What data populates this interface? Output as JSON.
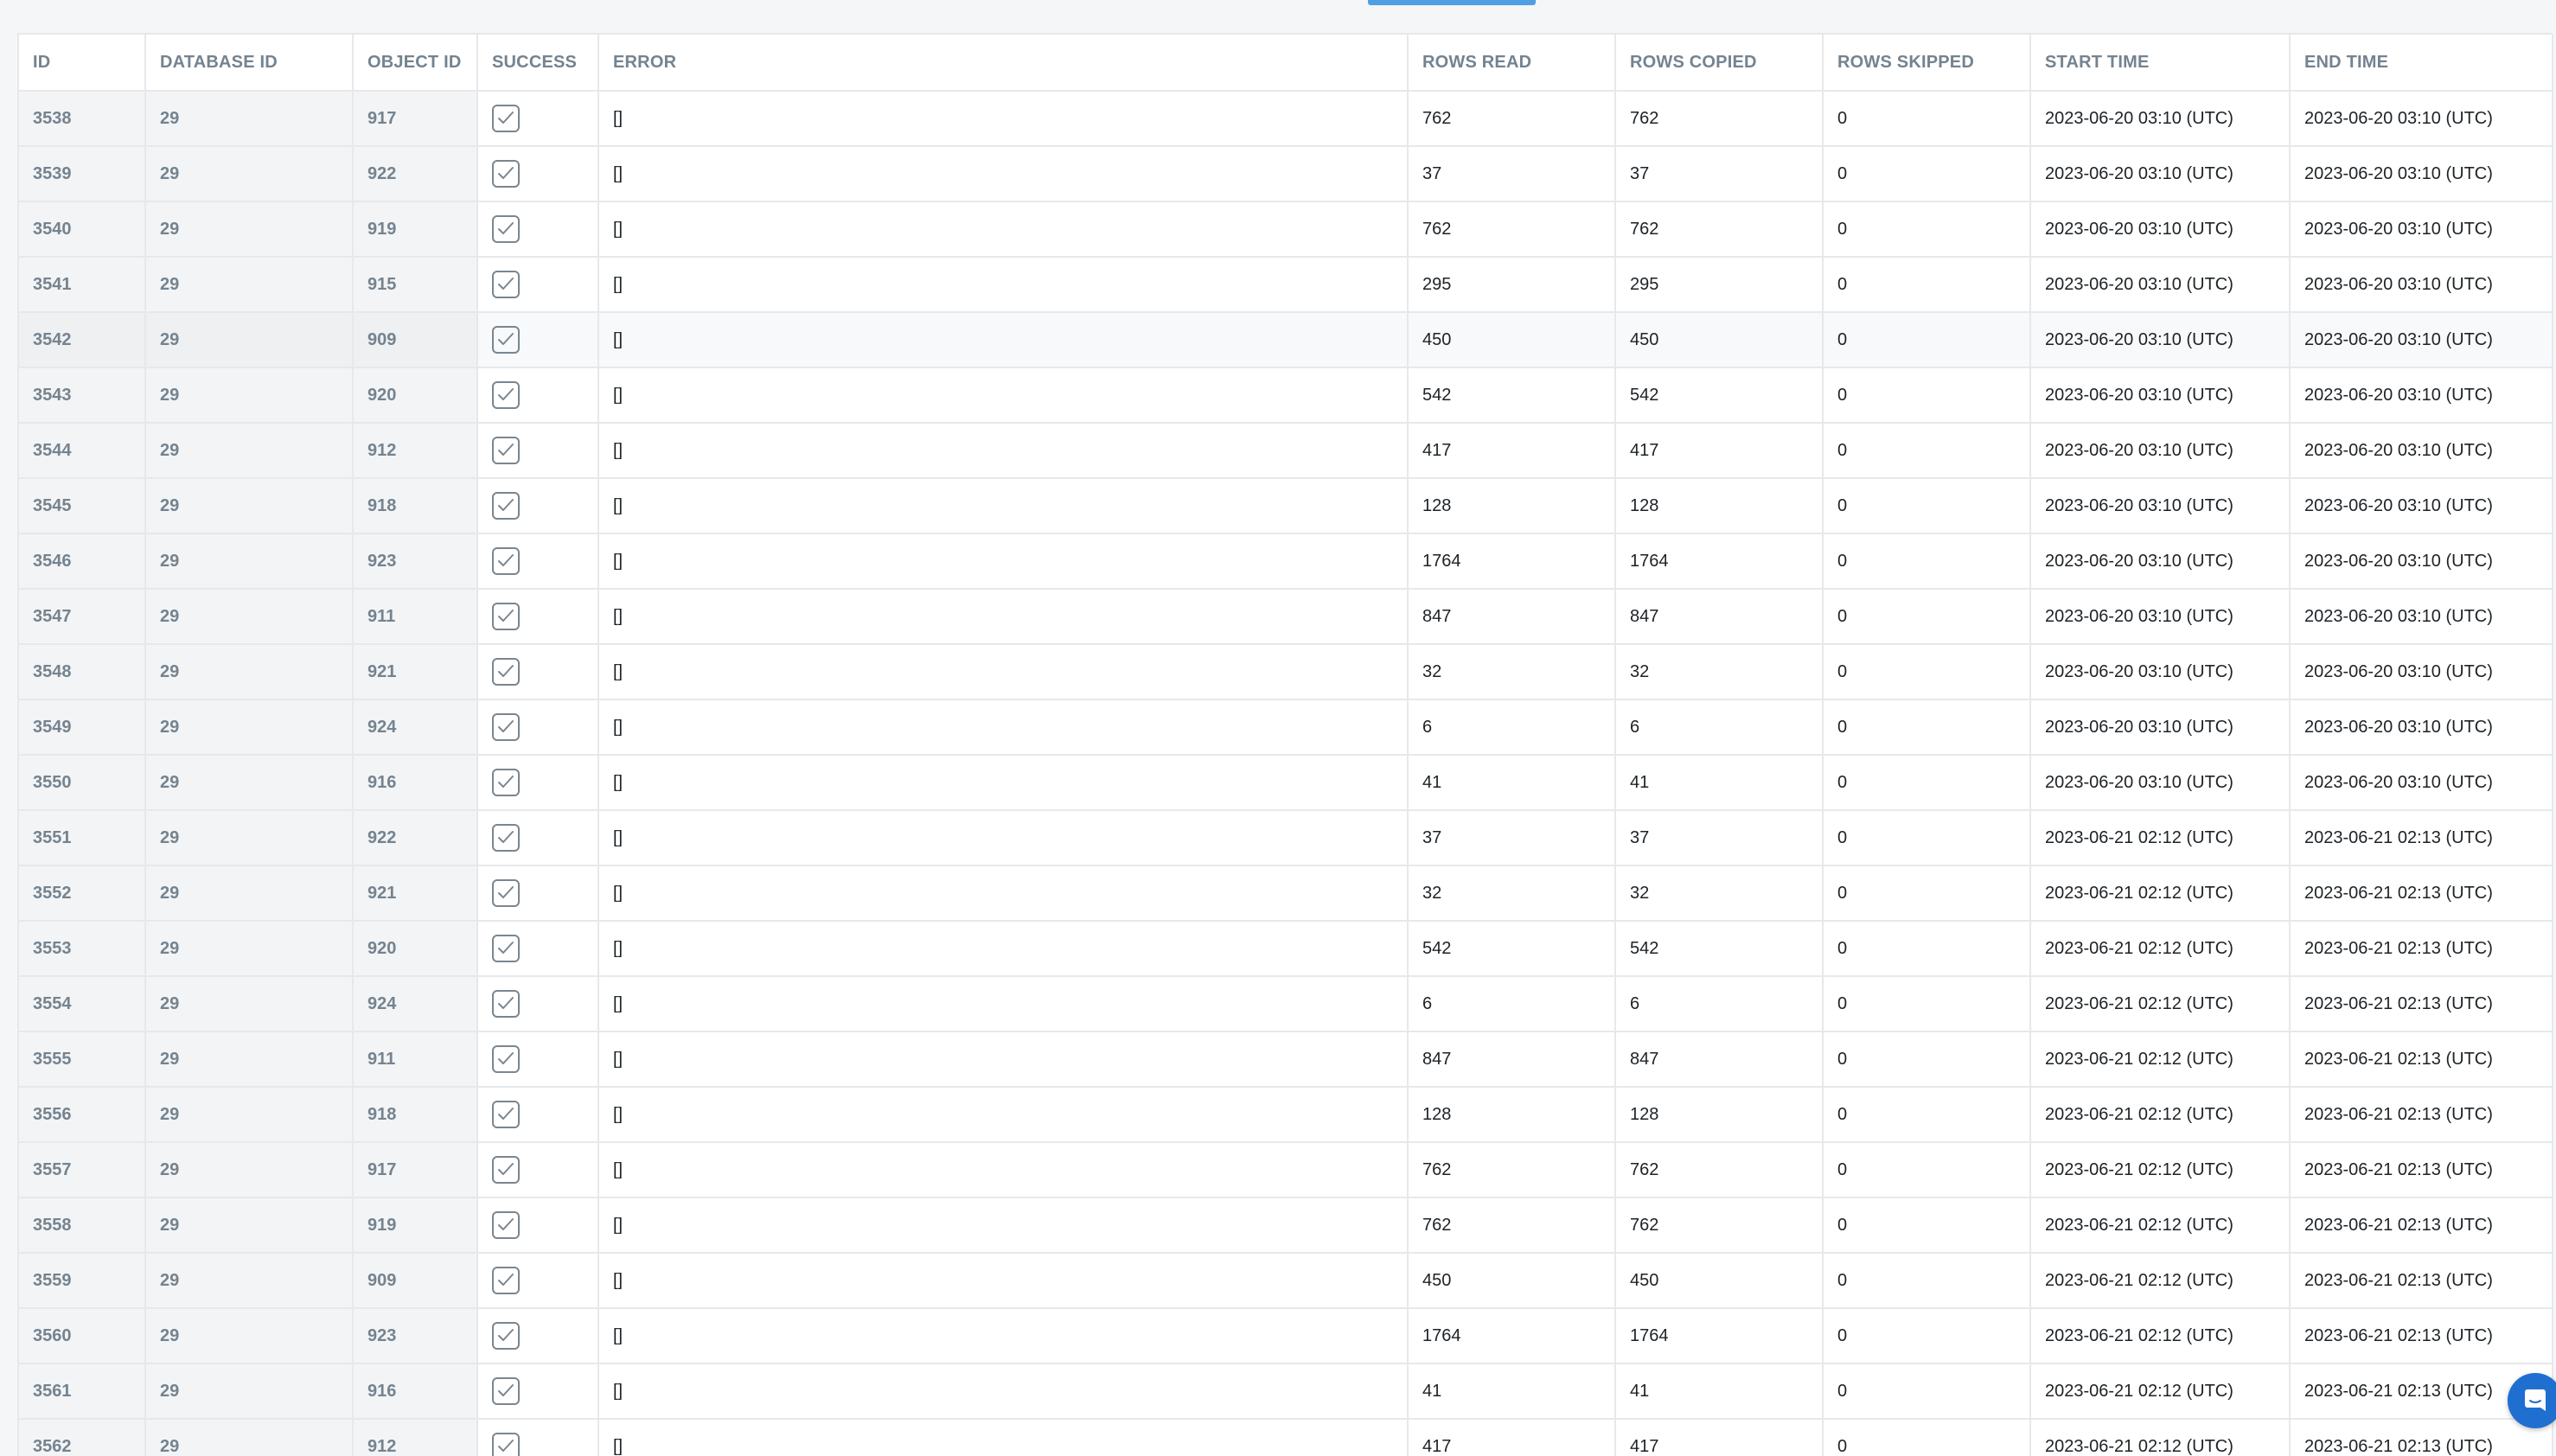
{
  "table": {
    "columns": [
      "ID",
      "DATABASE ID",
      "OBJECT ID",
      "SUCCESS",
      "ERROR",
      "ROWS READ",
      "ROWS COPIED",
      "ROWS SKIPPED",
      "START TIME",
      "END TIME"
    ],
    "rows": [
      {
        "id": "3538",
        "database_id": "29",
        "object_id": "917",
        "success": true,
        "error": "[]",
        "rows_read": "762",
        "rows_copied": "762",
        "rows_skipped": "0",
        "start_time": "2023-06-20 03:10 (UTC)",
        "end_time": "2023-06-20 03:10 (UTC)"
      },
      {
        "id": "3539",
        "database_id": "29",
        "object_id": "922",
        "success": true,
        "error": "[]",
        "rows_read": "37",
        "rows_copied": "37",
        "rows_skipped": "0",
        "start_time": "2023-06-20 03:10 (UTC)",
        "end_time": "2023-06-20 03:10 (UTC)"
      },
      {
        "id": "3540",
        "database_id": "29",
        "object_id": "919",
        "success": true,
        "error": "[]",
        "rows_read": "762",
        "rows_copied": "762",
        "rows_skipped": "0",
        "start_time": "2023-06-20 03:10 (UTC)",
        "end_time": "2023-06-20 03:10 (UTC)"
      },
      {
        "id": "3541",
        "database_id": "29",
        "object_id": "915",
        "success": true,
        "error": "[]",
        "rows_read": "295",
        "rows_copied": "295",
        "rows_skipped": "0",
        "start_time": "2023-06-20 03:10 (UTC)",
        "end_time": "2023-06-20 03:10 (UTC)"
      },
      {
        "id": "3542",
        "database_id": "29",
        "object_id": "909",
        "success": true,
        "error": "[]",
        "rows_read": "450",
        "rows_copied": "450",
        "rows_skipped": "0",
        "start_time": "2023-06-20 03:10 (UTC)",
        "end_time": "2023-06-20 03:10 (UTC)",
        "hover": true
      },
      {
        "id": "3543",
        "database_id": "29",
        "object_id": "920",
        "success": true,
        "error": "[]",
        "rows_read": "542",
        "rows_copied": "542",
        "rows_skipped": "0",
        "start_time": "2023-06-20 03:10 (UTC)",
        "end_time": "2023-06-20 03:10 (UTC)"
      },
      {
        "id": "3544",
        "database_id": "29",
        "object_id": "912",
        "success": true,
        "error": "[]",
        "rows_read": "417",
        "rows_copied": "417",
        "rows_skipped": "0",
        "start_time": "2023-06-20 03:10 (UTC)",
        "end_time": "2023-06-20 03:10 (UTC)"
      },
      {
        "id": "3545",
        "database_id": "29",
        "object_id": "918",
        "success": true,
        "error": "[]",
        "rows_read": "128",
        "rows_copied": "128",
        "rows_skipped": "0",
        "start_time": "2023-06-20 03:10 (UTC)",
        "end_time": "2023-06-20 03:10 (UTC)"
      },
      {
        "id": "3546",
        "database_id": "29",
        "object_id": "923",
        "success": true,
        "error": "[]",
        "rows_read": "1764",
        "rows_copied": "1764",
        "rows_skipped": "0",
        "start_time": "2023-06-20 03:10 (UTC)",
        "end_time": "2023-06-20 03:10 (UTC)"
      },
      {
        "id": "3547",
        "database_id": "29",
        "object_id": "911",
        "success": true,
        "error": "[]",
        "rows_read": "847",
        "rows_copied": "847",
        "rows_skipped": "0",
        "start_time": "2023-06-20 03:10 (UTC)",
        "end_time": "2023-06-20 03:10 (UTC)"
      },
      {
        "id": "3548",
        "database_id": "29",
        "object_id": "921",
        "success": true,
        "error": "[]",
        "rows_read": "32",
        "rows_copied": "32",
        "rows_skipped": "0",
        "start_time": "2023-06-20 03:10 (UTC)",
        "end_time": "2023-06-20 03:10 (UTC)"
      },
      {
        "id": "3549",
        "database_id": "29",
        "object_id": "924",
        "success": true,
        "error": "[]",
        "rows_read": "6",
        "rows_copied": "6",
        "rows_skipped": "0",
        "start_time": "2023-06-20 03:10 (UTC)",
        "end_time": "2023-06-20 03:10 (UTC)"
      },
      {
        "id": "3550",
        "database_id": "29",
        "object_id": "916",
        "success": true,
        "error": "[]",
        "rows_read": "41",
        "rows_copied": "41",
        "rows_skipped": "0",
        "start_time": "2023-06-20 03:10 (UTC)",
        "end_time": "2023-06-20 03:10 (UTC)"
      },
      {
        "id": "3551",
        "database_id": "29",
        "object_id": "922",
        "success": true,
        "error": "[]",
        "rows_read": "37",
        "rows_copied": "37",
        "rows_skipped": "0",
        "start_time": "2023-06-21 02:12 (UTC)",
        "end_time": "2023-06-21 02:13 (UTC)"
      },
      {
        "id": "3552",
        "database_id": "29",
        "object_id": "921",
        "success": true,
        "error": "[]",
        "rows_read": "32",
        "rows_copied": "32",
        "rows_skipped": "0",
        "start_time": "2023-06-21 02:12 (UTC)",
        "end_time": "2023-06-21 02:13 (UTC)"
      },
      {
        "id": "3553",
        "database_id": "29",
        "object_id": "920",
        "success": true,
        "error": "[]",
        "rows_read": "542",
        "rows_copied": "542",
        "rows_skipped": "0",
        "start_time": "2023-06-21 02:12 (UTC)",
        "end_time": "2023-06-21 02:13 (UTC)"
      },
      {
        "id": "3554",
        "database_id": "29",
        "object_id": "924",
        "success": true,
        "error": "[]",
        "rows_read": "6",
        "rows_copied": "6",
        "rows_skipped": "0",
        "start_time": "2023-06-21 02:12 (UTC)",
        "end_time": "2023-06-21 02:13 (UTC)"
      },
      {
        "id": "3555",
        "database_id": "29",
        "object_id": "911",
        "success": true,
        "error": "[]",
        "rows_read": "847",
        "rows_copied": "847",
        "rows_skipped": "0",
        "start_time": "2023-06-21 02:12 (UTC)",
        "end_time": "2023-06-21 02:13 (UTC)"
      },
      {
        "id": "3556",
        "database_id": "29",
        "object_id": "918",
        "success": true,
        "error": "[]",
        "rows_read": "128",
        "rows_copied": "128",
        "rows_skipped": "0",
        "start_time": "2023-06-21 02:12 (UTC)",
        "end_time": "2023-06-21 02:13 (UTC)"
      },
      {
        "id": "3557",
        "database_id": "29",
        "object_id": "917",
        "success": true,
        "error": "[]",
        "rows_read": "762",
        "rows_copied": "762",
        "rows_skipped": "0",
        "start_time": "2023-06-21 02:12 (UTC)",
        "end_time": "2023-06-21 02:13 (UTC)"
      },
      {
        "id": "3558",
        "database_id": "29",
        "object_id": "919",
        "success": true,
        "error": "[]",
        "rows_read": "762",
        "rows_copied": "762",
        "rows_skipped": "0",
        "start_time": "2023-06-21 02:12 (UTC)",
        "end_time": "2023-06-21 02:13 (UTC)"
      },
      {
        "id": "3559",
        "database_id": "29",
        "object_id": "909",
        "success": true,
        "error": "[]",
        "rows_read": "450",
        "rows_copied": "450",
        "rows_skipped": "0",
        "start_time": "2023-06-21 02:12 (UTC)",
        "end_time": "2023-06-21 02:13 (UTC)"
      },
      {
        "id": "3560",
        "database_id": "29",
        "object_id": "923",
        "success": true,
        "error": "[]",
        "rows_read": "1764",
        "rows_copied": "1764",
        "rows_skipped": "0",
        "start_time": "2023-06-21 02:12 (UTC)",
        "end_time": "2023-06-21 02:13 (UTC)"
      },
      {
        "id": "3561",
        "database_id": "29",
        "object_id": "916",
        "success": true,
        "error": "[]",
        "rows_read": "41",
        "rows_copied": "41",
        "rows_skipped": "0",
        "start_time": "2023-06-21 02:12 (UTC)",
        "end_time": "2023-06-21 02:13 (UTC)"
      },
      {
        "id": "3562",
        "database_id": "29",
        "object_id": "912",
        "success": true,
        "error": "[]",
        "rows_read": "417",
        "rows_copied": "417",
        "rows_skipped": "0",
        "start_time": "2023-06-21 02:12 (UTC)",
        "end_time": "2023-06-21 02:13 (UTC)"
      }
    ]
  },
  "icons": {
    "success": "checkbox-checked-icon",
    "chat": "chat-icon"
  },
  "colors": {
    "accent": "#509ee3",
    "chat_bubble": "#1f6fd1",
    "header_text": "#74838f",
    "border": "#e6e8eb"
  }
}
